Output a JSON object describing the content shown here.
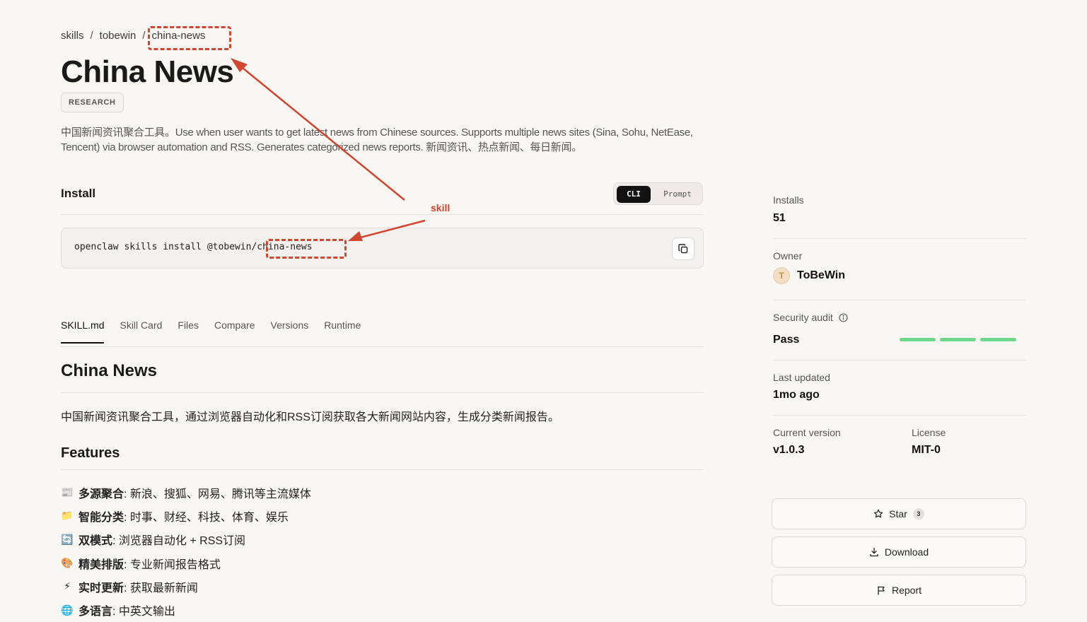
{
  "breadcrumb": {
    "root": "skills",
    "owner": "tobewin",
    "current": "china-news",
    "separator": "/"
  },
  "skill": {
    "title": "China News",
    "category_tag": "RESEARCH",
    "description": "中国新闻资讯聚合工具。Use when user wants to get latest news from Chinese sources. Supports multiple news sites (Sina, Sohu, NetEase, Tencent) via browser automation and RSS. Generates categorized news reports. 新闻资讯、热点新闻、每日新闻。"
  },
  "install": {
    "heading": "Install",
    "modes": [
      "CLI",
      "Prompt"
    ],
    "active_mode": "CLI",
    "command": "openclaw skills install @tobewin/china-news",
    "copy_icon": "copy-icon"
  },
  "tabs": [
    "SKILL.md",
    "Skill Card",
    "Files",
    "Compare",
    "Versions",
    "Runtime"
  ],
  "active_tab": "SKILL.md",
  "readme": {
    "h1": "China News",
    "intro": "中国新闻资讯聚合工具，通过浏览器自动化和RSS订阅获取各大新闻网站内容，生成分类新闻报告。",
    "features_heading": "Features",
    "features": [
      {
        "icon": "newspaper-icon",
        "glyph": "📰",
        "bold": "多源聚合",
        "text": ": 新浪、搜狐、网易、腾讯等主流媒体"
      },
      {
        "icon": "folder-icon",
        "glyph": "📁",
        "bold": "智能分类",
        "text": ": 时事、财经、科技、体育、娱乐"
      },
      {
        "icon": "refresh-icon",
        "glyph": "🔄",
        "bold": "双模式",
        "text": ": 浏览器自动化 + RSS订阅"
      },
      {
        "icon": "palette-icon",
        "glyph": "🎨",
        "bold": "精美排版",
        "text": ": 专业新闻报告格式"
      },
      {
        "icon": "lightning-icon",
        "glyph": "⚡",
        "bold": "实时更新",
        "text": ": 获取最新新闻"
      },
      {
        "icon": "globe-icon",
        "glyph": "🌐",
        "bold": "多语言",
        "text": ": 中英文输出"
      }
    ]
  },
  "sidebar": {
    "installs_label": "Installs",
    "installs_value": "51",
    "owner_label": "Owner",
    "owner_name": "ToBeWin",
    "owner_initial": "T",
    "security_label": "Security audit",
    "security_value": "Pass",
    "security_bars_passed": 3,
    "security_bars_total": 3,
    "updated_label": "Last updated",
    "updated_value": "1mo ago",
    "version_label": "Current version",
    "version_value": "v1.0.3",
    "license_label": "License",
    "license_value": "MIT-0",
    "star_label": "Star",
    "star_count": "3",
    "download_label": "Download",
    "report_label": "Report"
  },
  "annotations": {
    "arrow_label": "skill",
    "color": "#d2452e"
  },
  "colors": {
    "background": "#f9f7f4",
    "accent_dark": "#111111",
    "pass_green": "#6fd68a"
  }
}
